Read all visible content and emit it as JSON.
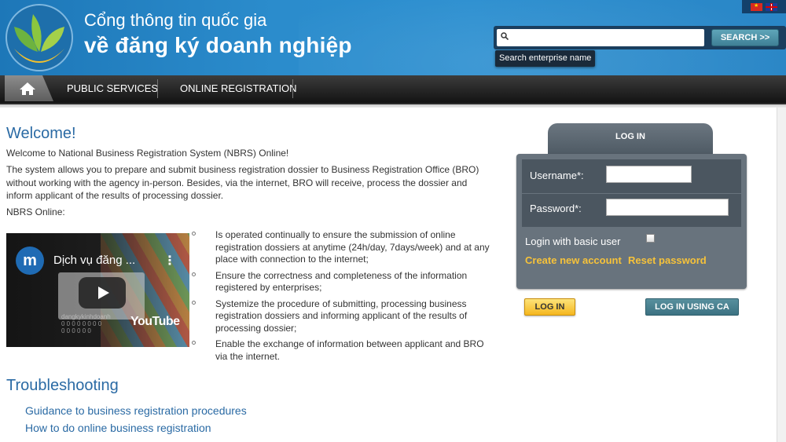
{
  "header": {
    "title_line1": "Cổng thông tin quốc gia",
    "title_line2": "về đăng ký doanh nghiệp",
    "search_button": "SEARCH >>",
    "search_tooltip": "Search enterprise name",
    "search_value": ""
  },
  "nav": {
    "items": [
      "PUBLIC SERVICES",
      "ONLINE REGISTRATION"
    ]
  },
  "welcome": {
    "title": "Welcome!",
    "p1": "Welcome to National Business Registration System (NBRS) Online!",
    "p2": "The system allows you to prepare and submit business registration dossier to Business Registration Office (BRO) without working with the agency in-person. Besides, via the internet, BRO will receive, process the dossier and inform applicant of the results of processing dossier.",
    "p3": "NBRS Online:"
  },
  "video": {
    "avatar_letter": "m",
    "title": "Dịch vụ đăng ...",
    "brand": "YouTube"
  },
  "bullets": [
    "Is operated continually to ensure the submission of online registration dossiers at anytime (24h/day, 7days/week) and at any place with connection to the internet;",
    "Ensure the correctness and completeness of the information registered by enterprises;",
    "Systemize the procedure of submitting, processing business registration dossiers and informing applicant of the results of processing dossier;",
    "Enable the exchange of information between applicant and BRO via the internet."
  ],
  "troubleshooting": {
    "title": "Troubleshooting",
    "links": [
      "Guidance to business registration procedures",
      "How to do online business registration"
    ]
  },
  "login": {
    "tab": "LOG IN",
    "username_label": "Username*:",
    "password_label": "Password*:",
    "username_value": "",
    "password_value": "",
    "basic_user": "Login with basic user",
    "create_account": "Create new account",
    "reset_password": "Reset password",
    "login_button": "LOG IN",
    "ca_button": "LOG IN USING CA"
  },
  "colors": {
    "header_blue": "#2b8ccc",
    "link_blue": "#2a6aa4",
    "accent_yellow": "#f6c23a"
  }
}
